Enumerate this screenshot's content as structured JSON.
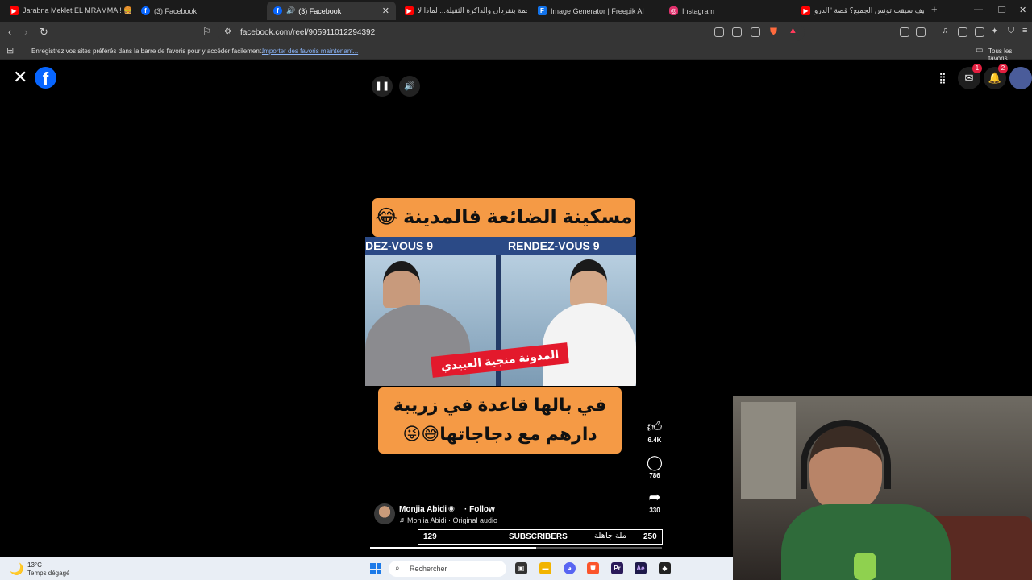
{
  "browser": {
    "tabs": [
      {
        "title": "Jarabna Meklet EL MRAMMA ! 🍔 -",
        "favicon": "youtube-icon",
        "color": "#ff0000"
      },
      {
        "title": "(3) Facebook",
        "favicon": "facebook-icon",
        "color": "#0866ff"
      },
      {
        "title": "(3) Facebook",
        "favicon": "facebook-icon",
        "color": "#0866ff",
        "active": true
      },
      {
        "title": "ملحمة بنقردان والذاكرة الثقيلة... لماذا لا",
        "favicon": "youtube-icon",
        "color": "#ff0000"
      },
      {
        "title": "Image Generator | Freepik AI",
        "favicon": "freepik-icon",
        "color": "#1273eb"
      },
      {
        "title": "Instagram",
        "favicon": "instagram-icon",
        "color": "#e1306c"
      },
      {
        "title": "كيف سيقت تونس الجميع؟ قصة \"الدرو",
        "favicon": "youtube-icon",
        "color": "#ff0000"
      }
    ],
    "url": "facebook.com/reel/905911012294392",
    "bookmarks_message": "Enregistrez vos sites préférés dans la barre de favoris pour y accéder facilement.",
    "bookmarks_link": "Importer des favoris maintenant...",
    "all_bookmarks": "Tous les favoris"
  },
  "facebook": {
    "logo": "f",
    "notifications": {
      "messenger_badge": "1",
      "bell_badge": "2"
    }
  },
  "reel": {
    "caption_top": "مسكينة الضائعة فالمدينة 😂",
    "banner_left": "DEZ-VOUS 9",
    "banner_right": "RENDEZ-VOUS 9",
    "name_tag": "المدونة منجية العبيدي",
    "caption_bottom_line1": "في بالها قاعدة في زريبة",
    "caption_bottom_line2": "دارهم مع دجاجاتها😅😜",
    "likes": "6.4K",
    "comments": "786",
    "shares": "330",
    "author": "Monjia Abidi",
    "follow": "· Follow",
    "audio": "Monjia Abidi · Original audio",
    "progress": 0.57
  },
  "subscribers_bar": {
    "left": "129",
    "label": "SUBSCRIBERS",
    "arabic": "ملة جاهلة",
    "right": "250"
  },
  "taskbar": {
    "temperature": "13°C",
    "weather": "Temps dégagé",
    "search": "Rechercher"
  }
}
